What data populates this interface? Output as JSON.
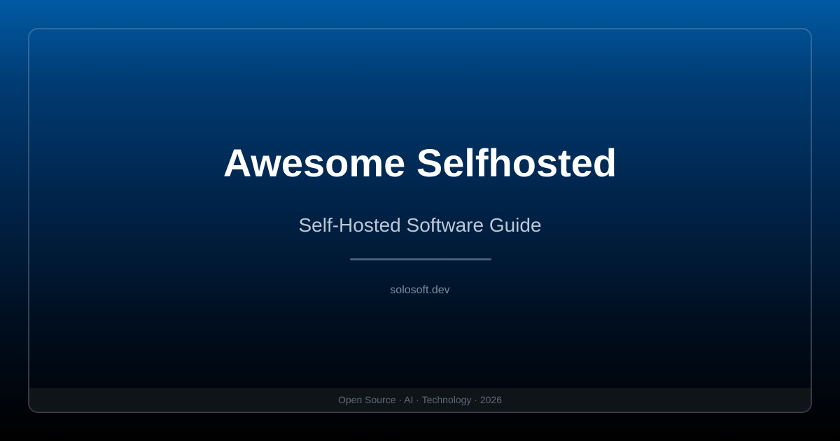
{
  "card": {
    "title": "Awesome Selfhosted",
    "subtitle": "Self-Hosted Software Guide",
    "site": "solosoft.dev",
    "footer": "Open Source · AI · Technology · 2026"
  }
}
